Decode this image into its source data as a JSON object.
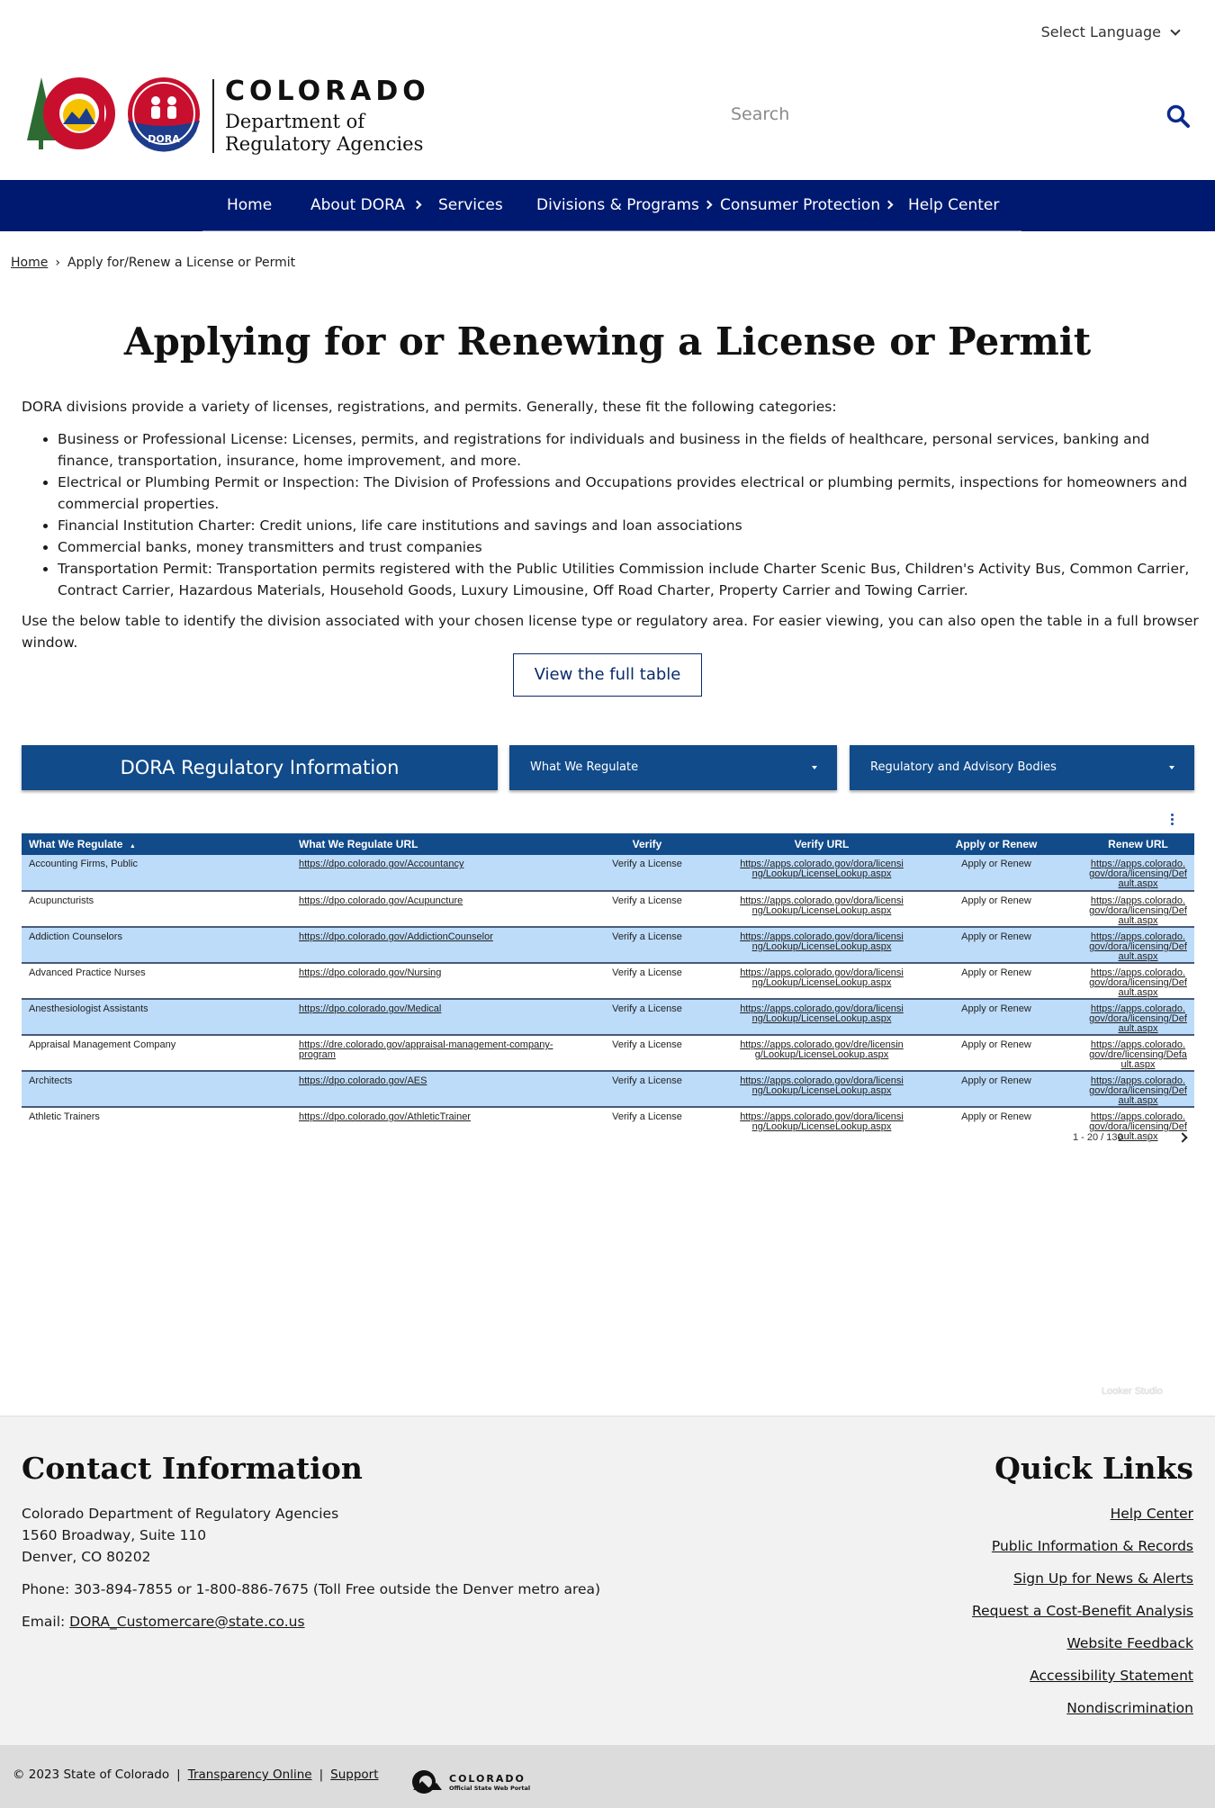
{
  "language": {
    "label": "Select Language"
  },
  "logo": {
    "state": "COLORADO",
    "dept_line1": "Department of",
    "dept_line2": "Regulatory Agencies",
    "seal_text": "DORA"
  },
  "search": {
    "placeholder": "Search"
  },
  "nav": {
    "items": [
      "Home",
      "About DORA",
      "Services",
      "Divisions & Programs",
      "Consumer Protection",
      "Help Center"
    ]
  },
  "breadcrumb": {
    "home": "Home",
    "separator": "›",
    "current": "Apply for/Renew a License or Permit"
  },
  "page": {
    "title": "Applying for or Renewing a License or Permit",
    "intro": "DORA divisions provide a variety of licenses, registrations, and permits. Generally, these fit the following categories:",
    "bullets": [
      "Business or Professional License: Licenses, permits, and registrations for individuals and business in the fields of healthcare, personal services, banking and finance, transportation, insurance, home improvement, and more.",
      "Electrical or Plumbing Permit or Inspection: The Division of Professions and Occupations provides electrical or plumbing permits, inspections for homeowners and commercial properties.",
      "Financial Institution Charter: Credit unions, life care institutions and savings and loan associations",
      "Commercial banks, money transmitters and trust companies",
      "Transportation Permit: Transportation permits registered with the Public Utilities Commission include Charter Scenic Bus, Children's Activity Bus, Common Carrier, Contract Carrier, Hazardous Materials, Household Goods, Luxury Limousine, Off Road Charter, Property Carrier and Towing Carrier."
    ],
    "outro": "Use the below table to identify the division associated with your chosen license type or regulatory area. For easier viewing, you can also open the table in a full browser window.",
    "view_button": "View the full table"
  },
  "dashboard": {
    "title": "DORA Regulatory Information",
    "filter1": "What We Regulate",
    "filter2": "Regulatory and Advisory Bodies",
    "columns": [
      "What We Regulate",
      "What We Regulate URL",
      "Verify",
      "Verify URL",
      "Apply or Renew",
      "Renew URL"
    ],
    "sort_indicator": "▲",
    "rows": [
      [
        "Accounting Firms, Public",
        "https://dpo.colorado.gov/Accountancy",
        "Verify a License",
        "https://apps.colorado.gov/dora/licensing/Lookup/LicenseLookup.aspx",
        "Apply or Renew",
        "https://apps.colorado.gov/dora/licensing/Default.aspx"
      ],
      [
        "Acupuncturists",
        "https://dpo.colorado.gov/Acupuncture",
        "Verify a License",
        "https://apps.colorado.gov/dora/licensing/Lookup/LicenseLookup.aspx",
        "Apply or Renew",
        "https://apps.colorado.gov/dora/licensing/Default.aspx"
      ],
      [
        "Addiction Counselors",
        "https://dpo.colorado.gov/AddictionCounselor",
        "Verify a License",
        "https://apps.colorado.gov/dora/licensing/Lookup/LicenseLookup.aspx",
        "Apply or Renew",
        "https://apps.colorado.gov/dora/licensing/Default.aspx"
      ],
      [
        "Advanced Practice Nurses",
        "https://dpo.colorado.gov/Nursing",
        "Verify a License",
        "https://apps.colorado.gov/dora/licensing/Lookup/LicenseLookup.aspx",
        "Apply or Renew",
        "https://apps.colorado.gov/dora/licensing/Default.aspx"
      ],
      [
        "Anesthesiologist Assistants",
        "https://dpo.colorado.gov/Medical",
        "Verify a License",
        "https://apps.colorado.gov/dora/licensing/Lookup/LicenseLookup.aspx",
        "Apply or Renew",
        "https://apps.colorado.gov/dora/licensing/Default.aspx"
      ],
      [
        "Appraisal Management Company",
        "https://dre.colorado.gov/appraisal-management-company-program",
        "Verify a License",
        "https://apps.colorado.gov/dre/licensing/Lookup/LicenseLookup.aspx",
        "Apply or Renew",
        "https://apps.colorado.gov/dre/licensing/Default.aspx"
      ],
      [
        "Architects",
        "https://dpo.colorado.gov/AES",
        "Verify a License",
        "https://apps.colorado.gov/dora/licensing/Lookup/LicenseLookup.aspx",
        "Apply or Renew",
        "https://apps.colorado.gov/dora/licensing/Default.aspx"
      ],
      [
        "Athletic Trainers",
        "https://dpo.colorado.gov/AthleticTrainer",
        "Verify a License",
        "https://apps.colorado.gov/dora/licensing/Lookup/LicenseLookup.aspx",
        "Apply or Renew",
        "https://apps.colorado.gov/dora/licensing/Default.aspx"
      ]
    ],
    "pagination": "1 - 20 / 130",
    "watermark": "Looker Studio"
  },
  "footer": {
    "contact_title": "Contact Information",
    "org": "Colorado Department of Regulatory Agencies",
    "street": "1560 Broadway, Suite 110",
    "city": "Denver, CO 80202",
    "phone": "Phone: 303-894-7855 or 1-800-886-7675 (Toll Free outside the Denver metro area)",
    "email_label": "Email: ",
    "email": "DORA_Customercare@state.co.us",
    "quick_title": "Quick Links",
    "links": [
      "Help Center",
      "Public Information & Records",
      "Sign Up for News & Alerts",
      "Request a Cost-Benefit Analysis",
      "Website Feedback",
      "Accessibility Statement",
      "Nondiscrimination"
    ]
  },
  "bottom": {
    "copyright": "© 2023 State of Colorado",
    "transparency": "Transparency Online",
    "support": "Support",
    "portal_name": "COLORADO",
    "portal_sub": "Official State Web Portal"
  },
  "colors": {
    "navy": "#001970",
    "table_blue": "#114b8a",
    "row_alt": "#bddcfa",
    "dora_red": "#c8102e"
  },
  "icons": {
    "search": "search-icon",
    "language": "chevron-down-icon",
    "more": "kebab-menu-icon"
  }
}
